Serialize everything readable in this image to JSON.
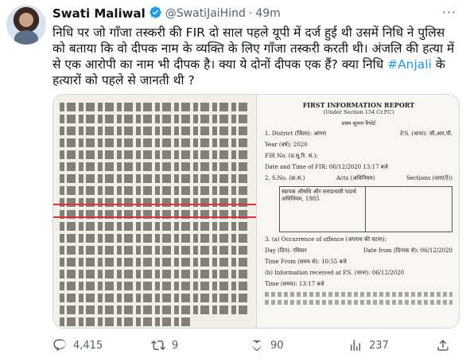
{
  "tweet": {
    "author_name": "Swati Maliwal",
    "handle": "@SwatiJaiHind",
    "separator": "·",
    "time": "49m",
    "more_label": "···",
    "text_before": "निधि पर जो गाँजा तस्करी की FIR दो साल पहले यूपी में दर्ज हुई थी उसमें निधि ने पुलिस को बताया कि वो दीपक नाम के व्यक्ति के लिए गाँजा तस्करी करती थी। अंजलि की हत्या में से एक आरोपी का नाम भी दीपक है। क्या ये दोनों दीपक एक हैं? क्या निधि ",
    "hashtag": "#Anjali",
    "text_after": " के हत्यारों को पहले से जानती थी ?"
  },
  "document_right": {
    "title": "FIRST INFORMATION REPORT",
    "subtitle": "(Under Section 154 Cr.P.C)",
    "subtitle_hindi": "प्रथम सूचना रिपोर्ट",
    "district_label": "1. District (जिला): आगरा",
    "ps_label": "P.S. (थाना): जी.आर.पी.",
    "year_label": "Year (वर्ष): 2020",
    "fir_no_label": "FIR No. (प्र.सू.रि. सं.):",
    "date_label": "Date and Time of FIR: 06/12/2020 13:17 बजे",
    "sno_label": "2. S.No. (क्र.सं.)",
    "acts_label": "Acts (अधिनियम)",
    "sections_label": "Sections (धारा(एँ))",
    "act1": "स्वापक औषधि और मनःप्रभावी पदार्थ अधिनियम, 1985",
    "occurrence_label": "3. (a) Occurrence of offence (अपराध की घटना):",
    "day_label": "Day (दिन): रविवार",
    "date_from_label": "Date from (दिनांक से): 06/12/2020",
    "time_from_label": "Time From (समय से): 10:55 बजे",
    "info_label": "(b) Information received at P.S. (थाना): 06/12/2020",
    "time_label": "Time (समय): 13:17 बजे"
  },
  "actions": {
    "replies": "4,415",
    "retweets": "9",
    "likes": "90",
    "views": "237"
  },
  "colors": {
    "accent": "#1d9bf0",
    "secondary_text": "#536471",
    "highlight_line": "#e0323b"
  },
  "icons": [
    "verified-badge-icon",
    "more-icon",
    "reply-icon",
    "retweet-icon",
    "like-icon",
    "views-icon",
    "share-icon"
  ]
}
